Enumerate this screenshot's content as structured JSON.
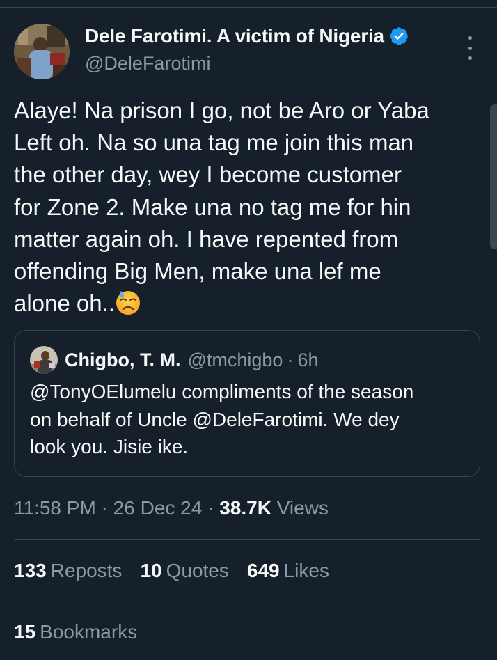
{
  "colors": {
    "background": "#15202b",
    "text_primary": "#f7f9f9",
    "text_secondary": "#8b98a5",
    "border": "#38444d",
    "verified_badge": "#1d9bf0"
  },
  "author": {
    "name": "Dele Farotimi. A victim of Nigeria",
    "handle": "@DeleFarotimi",
    "verified_icon": "verified-badge-icon",
    "avatar_icon": "avatar-photo"
  },
  "menu": {
    "more_icon": "more-vertical-icon"
  },
  "tweet": {
    "lines": [
      "Alaye! Na prison I go, not be Aro or Yaba",
      "Left oh. Na so una tag me join this man",
      "the other day, wey I become customer",
      "for Zone 2. Make una no tag me for hin",
      "matter again oh. I have repented from",
      "offending Big Men, make una lef me",
      "alone oh.."
    ],
    "emoji": "downcast-face-with-sweat-icon"
  },
  "quote": {
    "name": "Chigbo, T. M.",
    "handle": "@tmchigbo",
    "separator": "·",
    "time": "6h",
    "lines": [
      "@TonyOElumelu  compliments of the season",
      "on behalf of Uncle @DeleFarotimi. We dey",
      "look you. Jisie ike."
    ]
  },
  "meta": {
    "time": "11:58 PM",
    "sep1": " · ",
    "date": "26 Dec 24",
    "sep2": " · ",
    "views_count": "38.7K",
    "views_label": " Views"
  },
  "stats": {
    "reposts_count": "133",
    "reposts_label": "Reposts",
    "quotes_count": "10",
    "quotes_label": "Quotes",
    "likes_count": "649",
    "likes_label": "Likes",
    "bookmarks_count": "15",
    "bookmarks_label": "Bookmarks"
  }
}
